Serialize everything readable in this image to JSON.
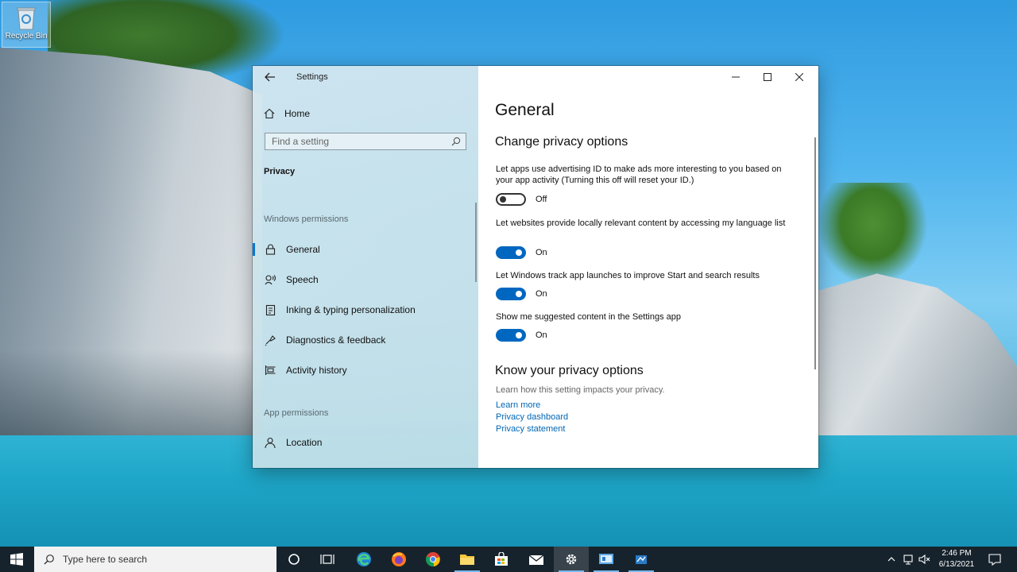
{
  "desktop": {
    "recycle_bin_label": "Recycle Bin"
  },
  "window": {
    "title": "Settings",
    "controls": [
      "minimize",
      "maximize",
      "close"
    ]
  },
  "nav": {
    "home_label": "Home",
    "search_placeholder": "Find a setting",
    "category": "Privacy",
    "windows_permissions_header": "Windows permissions",
    "items": [
      {
        "label": "General",
        "icon": "lock-icon",
        "active": true
      },
      {
        "label": "Speech",
        "icon": "speech-icon"
      },
      {
        "label": "Inking & typing personalization",
        "icon": "inking-icon"
      },
      {
        "label": "Diagnostics & feedback",
        "icon": "diagnostics-icon"
      },
      {
        "label": "Activity history",
        "icon": "activity-history-icon"
      }
    ],
    "app_permissions_header": "App permissions",
    "app_items": [
      {
        "label": "Location",
        "icon": "location-icon"
      }
    ]
  },
  "content": {
    "title": "General",
    "section1_title": "Change privacy options",
    "options": [
      {
        "text": "Let apps use advertising ID to make ads more interesting to you based on your app activity (Turning this off will reset your ID.)",
        "state": "Off",
        "on": false
      },
      {
        "text": "Let websites provide locally relevant content by accessing my language list",
        "state": "On",
        "on": true
      },
      {
        "text": "Let Windows track app launches to improve Start and search results",
        "state": "On",
        "on": true
      },
      {
        "text": "Show me suggested content in the Settings app",
        "state": "On",
        "on": true
      }
    ],
    "section2_title": "Know your privacy options",
    "section2_desc": "Learn how this setting impacts your privacy.",
    "links": [
      "Learn more",
      "Privacy dashboard",
      "Privacy statement"
    ]
  },
  "taskbar": {
    "search_placeholder": "Type here to search",
    "apps": [
      "cortana-icon",
      "task-view-icon",
      "edge-icon",
      "firefox-icon",
      "chrome-icon",
      "file-explorer-icon",
      "store-icon",
      "mail-icon",
      "settings-icon",
      "control-panel-icon",
      "network-tool-icon"
    ],
    "time": "2:46 PM",
    "date": "6/13/2021"
  },
  "colors": {
    "accent": "#0067c0",
    "link": "#0066b4",
    "taskbar": "#16232c"
  }
}
